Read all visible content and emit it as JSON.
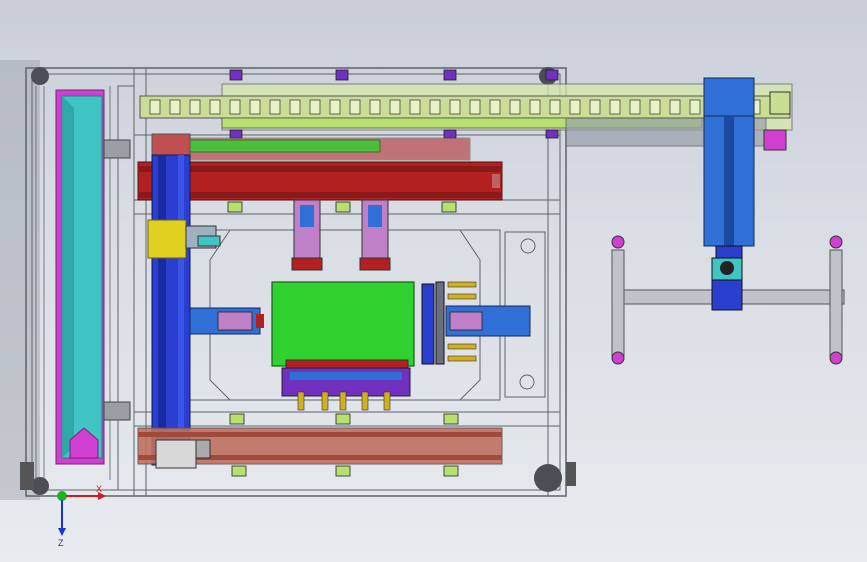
{
  "viewport": {
    "background_top": "#c9ced8",
    "background_bottom": "#e8ebef"
  },
  "triad": {
    "x_label": "X",
    "z_label": "Z",
    "x_color": "#d21a1a",
    "y_color": "#19b519",
    "z_color": "#1a34d2"
  },
  "colors": {
    "frame_gray": "#6f747c",
    "cyan_rail": "#40c4c4",
    "magenta_guard": "#d040d0",
    "blue_column": "#2a3fd0",
    "steel_blue": "#2f6fd6",
    "red_beam": "#b32020",
    "green_plate": "#2fd22f",
    "lime_chain": "#b8e070",
    "yellow_block": "#e0d020",
    "purple_mount": "#7030c0",
    "dark_red": "#8a1a1a",
    "salmon_beam": "#c07060"
  }
}
